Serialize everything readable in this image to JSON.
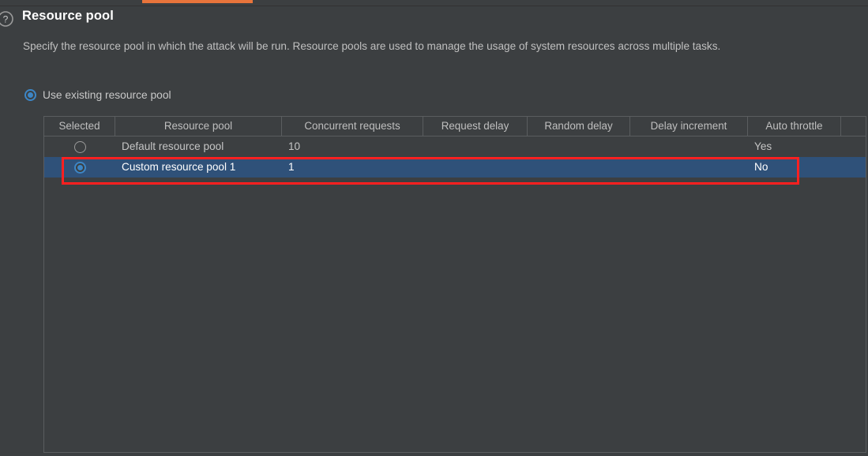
{
  "window": {
    "background_color": "#3c3f41",
    "accent_color": "#e8743b",
    "selection_color": "#2f5179",
    "annotation_color": "#ff2020"
  },
  "header": {
    "help_icon": "question-circle-icon",
    "title": "Resource pool",
    "description": "Specify the resource pool in which the attack will be run. Resource pools are used to manage the usage of system resources across multiple tasks."
  },
  "options": {
    "use_existing": {
      "label": "Use existing resource pool",
      "checked": true
    }
  },
  "table": {
    "columns": [
      "Selected",
      "Resource pool",
      "Concurrent requests",
      "Request delay",
      "Random delay",
      "Delay increment",
      "Auto throttle",
      ""
    ],
    "rows": [
      {
        "selected": false,
        "resource_pool": "Default resource pool",
        "concurrent_requests": "10",
        "request_delay": "",
        "random_delay": "",
        "delay_increment": "",
        "auto_throttle": "Yes"
      },
      {
        "selected": true,
        "resource_pool": "Custom resource pool 1",
        "concurrent_requests": "1",
        "request_delay": "",
        "random_delay": "",
        "delay_increment": "",
        "auto_throttle": "No"
      }
    ]
  }
}
